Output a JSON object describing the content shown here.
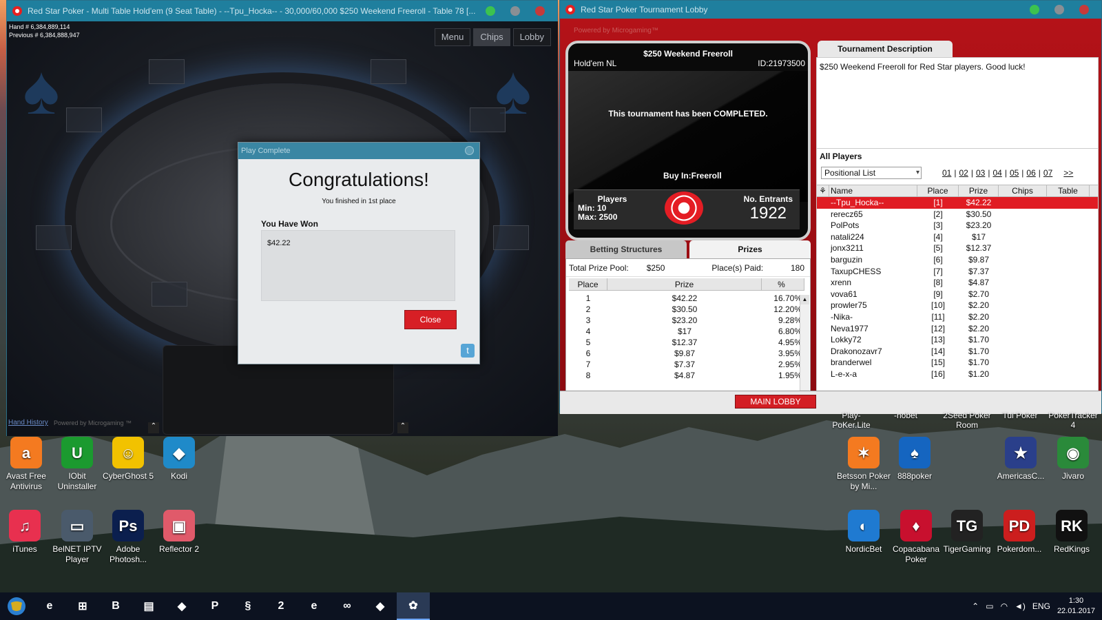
{
  "table_window": {
    "title": "Red Star Poker - Multi Table Hold'em (9 Seat Table) - --Tpu_Hocka-- - 30,000/60,000 $250 Weekend Freeroll - Table 78 [...",
    "hand_line": "Hand # 6,384,889,114",
    "previous_line": "Previous # 6,384,888,947",
    "buttons": [
      "Menu",
      "Chips",
      "Lobby"
    ],
    "footer_link": "Hand History",
    "footer_powered": "Powered by Microgaming ™"
  },
  "dialog": {
    "title": "Play Complete",
    "headline": "Congratulations!",
    "finished_text": "You finished in 1st place",
    "won_label": "You Have Won",
    "won_amount": "$42.22",
    "close_label": "Close",
    "twitter_icon": "t"
  },
  "lobby_window": {
    "title": "Red Star Poker Tournament Lobby",
    "powered": "Powered by Microgaming™",
    "tournament": {
      "name": "$250 Weekend Freeroll",
      "game": "Hold'em NL",
      "id": "ID:21973500",
      "status": "This tournament has been COMPLETED.",
      "buyin": "Buy In:Freeroll",
      "players_label": "Players",
      "min": "Min:  10",
      "max": "Max: 2500",
      "entrants_label": "No. Entrants",
      "entrants": "1922"
    },
    "description_tab": "Tournament Description",
    "description": "$250 Weekend Freeroll for Red Star players. Good luck!",
    "tabs": [
      "Betting Structures",
      "Prizes"
    ],
    "prize_pool_label": "Total Prize Pool:",
    "prize_pool": "$250",
    "places_paid_label": "Place(s) Paid:",
    "places_paid": "180",
    "prize_headers": [
      "Place",
      "Prize",
      "%"
    ],
    "prizes": [
      {
        "place": "1",
        "prize": "$42.22",
        "pct": "16.70%"
      },
      {
        "place": "2",
        "prize": "$30.50",
        "pct": "12.20%"
      },
      {
        "place": "3",
        "prize": "$23.20",
        "pct": "9.28%"
      },
      {
        "place": "4",
        "prize": "$17",
        "pct": "6.80%"
      },
      {
        "place": "5",
        "prize": "$12.37",
        "pct": "4.95%"
      },
      {
        "place": "6",
        "prize": "$9.87",
        "pct": "3.95%"
      },
      {
        "place": "7",
        "prize": "$7.37",
        "pct": "2.95%"
      },
      {
        "place": "8",
        "prize": "$4.87",
        "pct": "1.95%"
      }
    ],
    "all_players_title": "All Players",
    "list_select": "Positional List",
    "pages": [
      "01",
      "02",
      "03",
      "04",
      "05",
      "06",
      "07",
      ">>"
    ],
    "player_headers": [
      "Name",
      "Place",
      "Prize",
      "Chips",
      "Table"
    ],
    "players": [
      {
        "name": "--Tpu_Hocka--",
        "place": "[1]",
        "prize": "$42.22"
      },
      {
        "name": "rerecz65",
        "place": "[2]",
        "prize": "$30.50"
      },
      {
        "name": "PolPots",
        "place": "[3]",
        "prize": "$23.20"
      },
      {
        "name": "natali224",
        "place": "[4]",
        "prize": "$17"
      },
      {
        "name": "jonx3211",
        "place": "[5]",
        "prize": "$12.37"
      },
      {
        "name": "barguzin",
        "place": "[6]",
        "prize": "$9.87"
      },
      {
        "name": "TaxupCHESS",
        "place": "[7]",
        "prize": "$7.37"
      },
      {
        "name": "xrenn",
        "place": "[8]",
        "prize": "$4.87"
      },
      {
        "name": "vova61",
        "place": "[9]",
        "prize": "$2.70"
      },
      {
        "name": "prowler75",
        "place": "[10]",
        "prize": "$2.20"
      },
      {
        "name": "-Nika-",
        "place": "[11]",
        "prize": "$2.20"
      },
      {
        "name": "Neva1977",
        "place": "[12]",
        "prize": "$2.20"
      },
      {
        "name": "Lokky72",
        "place": "[13]",
        "prize": "$1.70"
      },
      {
        "name": "Drakonozavr7",
        "place": "[14]",
        "prize": "$1.70"
      },
      {
        "name": "branderwel",
        "place": "[15]",
        "prize": "$1.70"
      },
      {
        "name": "L-e-x-a",
        "place": "[16]",
        "prize": "$1.20"
      }
    ],
    "main_lobby": "MAIN LOBBY"
  },
  "desktop": {
    "partial_labels": [
      "Play-PoKer.Lite",
      "-nobet",
      "2Seed Poker Room",
      "Tui Poker",
      "PokerTracker 4"
    ],
    "icons_left": [
      {
        "label": "Avast Free Antivirus",
        "color": "#f47a20",
        "glyph": "a"
      },
      {
        "label": "IObit Uninstaller",
        "color": "#1b9a2f",
        "glyph": "U"
      },
      {
        "label": "CyberGhost 5",
        "color": "#f2c200",
        "glyph": "☺"
      },
      {
        "label": "Kodi",
        "color": "#1f8ac9",
        "glyph": "◆"
      },
      {
        "label": "iTunes",
        "color": "#e8304f",
        "glyph": "♫"
      },
      {
        "label": "BelNET IPTV Player",
        "color": "#4a5a6b",
        "glyph": "▭"
      },
      {
        "label": "Adobe Photosh...",
        "color": "#0b1f4e",
        "glyph": "Ps"
      },
      {
        "label": "Reflector 2",
        "color": "#e05a6a",
        "glyph": "▣"
      }
    ],
    "icons_right": [
      {
        "label": "Betsson Poker by Mi...",
        "color": "#f47a20",
        "glyph": "✶"
      },
      {
        "label": "888poker",
        "color": "#1565c0",
        "glyph": "♠"
      },
      {
        "label": "AmericasC...",
        "color": "#2a3f8a",
        "glyph": "★"
      },
      {
        "label": "Jivaro",
        "color": "#2a8a3a",
        "glyph": "◉"
      },
      {
        "label": "NordicBet",
        "color": "#1f7ad1",
        "glyph": "◐"
      },
      {
        "label": "Copacabana Poker",
        "color": "#c8102e",
        "glyph": "♦"
      },
      {
        "label": "TigerGaming",
        "color": "#222222",
        "glyph": "TG"
      },
      {
        "label": "Pokerdom...",
        "color": "#cc1e1e",
        "glyph": "PD"
      },
      {
        "label": "RedKings",
        "color": "#111111",
        "glyph": "RK"
      }
    ]
  },
  "taskbar": {
    "items": [
      "e",
      "⊞",
      "B",
      "▤",
      "◆",
      "P",
      "§",
      "2",
      "e",
      "∞",
      "◆",
      "✿"
    ],
    "language": "ENG",
    "time": "1:30",
    "date": "22.01.2017"
  }
}
